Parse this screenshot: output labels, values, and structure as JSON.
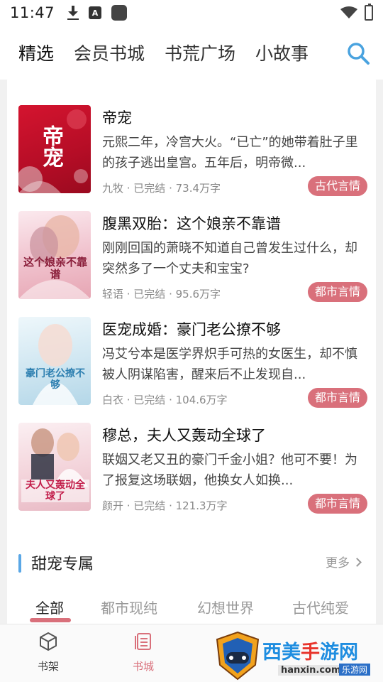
{
  "status_bar": {
    "time": "11:47",
    "icons": [
      "download-icon",
      "a-icon",
      "app-square-icon",
      "wifi-icon",
      "battery-icon"
    ]
  },
  "top_nav": {
    "tabs": [
      {
        "label": "精选",
        "active": true
      },
      {
        "label": "会员书城",
        "active": false
      },
      {
        "label": "书荒广场",
        "active": false
      },
      {
        "label": "小故事",
        "active": false
      }
    ],
    "search_icon": "search-icon"
  },
  "books": [
    {
      "title": "帝宠",
      "description": "元熙二年，冷宫大火。“已亡”的她带着肚子里的孩子逃出皇宫。五年后，明帝微...",
      "author": "九牧",
      "status": "已完结",
      "words": "73.4万字",
      "meta": "九牧 · 已完结 · 73.4万字",
      "tag": "古代言情",
      "cover_text": "帝宠",
      "cover_color": "#c8102e"
    },
    {
      "title": "腹黑双胎：这个娘亲不靠谱",
      "description": "刚刚回国的萧晓不知道自己曾发生过什么，却突然多了一个丈夫和宝宝?",
      "author": "轻语",
      "status": "已完结",
      "words": "95.6万字",
      "meta": "轻语 · 已完结 · 95.6万字",
      "tag": "都市言情",
      "cover_text": "这个娘亲不靠谱",
      "cover_color": "#f2c6cf"
    },
    {
      "title": "医宠成婚：豪门老公撩不够",
      "description": "冯艾兮本是医学界炽手可热的女医生，却不慎被人阴谋陷害，醒来后不止发现自...",
      "author": "白衣",
      "status": "已完结",
      "words": "104.6万字",
      "meta": "白衣 · 已完结 · 104.6万字",
      "tag": "都市言情",
      "cover_text": "豪门老公撩不够",
      "cover_color": "#d7ecf5"
    },
    {
      "title": "穆总，夫人又轰动全球了",
      "description": "联姻又老又丑的豪门千金小姐？他可不要！为了报复这场联姻，他换女人如换...",
      "author": "颜开",
      "status": "已完结",
      "words": "121.3万字",
      "meta": "颜开 · 已完结 · 121.3万字",
      "tag": "都市言情",
      "cover_text": "夫人又轰动全球了",
      "cover_color": "#f5d6dc"
    }
  ],
  "section": {
    "title": "甜宠专属",
    "more_label": "更多",
    "tabs": [
      {
        "label": "全部",
        "active": true
      },
      {
        "label": "都市现纯",
        "active": false
      },
      {
        "label": "幻想世界",
        "active": false
      },
      {
        "label": "古代纯爱",
        "active": false
      }
    ]
  },
  "bottom_nav": {
    "items": [
      {
        "label": "书架",
        "icon": "bookshelf-cube-icon",
        "active": false
      },
      {
        "label": "书城",
        "icon": "bookstore-list-icon",
        "active": true
      }
    ]
  },
  "watermark": {
    "brand_blue_1": "西美",
    "brand_red": "手",
    "brand_blue_2": "游网",
    "url": "hanxin.com",
    "sub": "乐游网"
  },
  "colors": {
    "accent_pink": "#d9707b",
    "accent_blue": "#5aa7e6",
    "search_blue": "#4aa3df"
  }
}
